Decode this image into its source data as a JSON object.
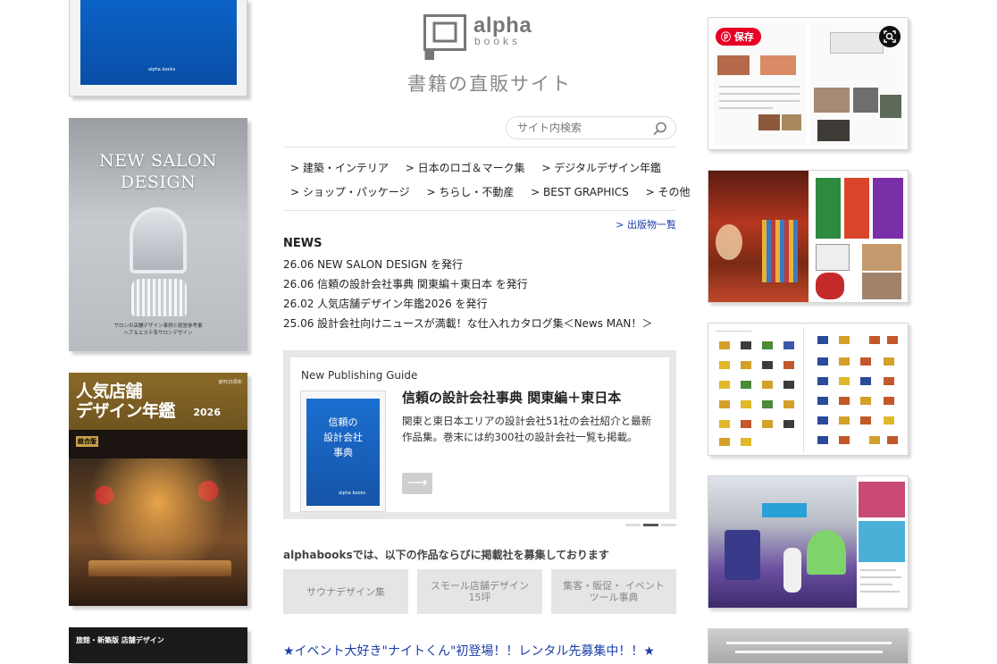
{
  "brand": {
    "name": "alpha",
    "sub": "books",
    "tagline": "書籍の直販サイト"
  },
  "search": {
    "placeholder": "サイト内検索"
  },
  "nav": {
    "row1": [
      "> 建築・インテリア",
      "> 日本のロゴ＆マーク集",
      "> デジタルデザイン年鑑"
    ],
    "row2": [
      "> ショップ・パッケージ",
      "> ちらし・不動産",
      "> BEST GRAPHICS",
      "> その他"
    ],
    "more": "> 出版物一覧"
  },
  "news": {
    "heading": "NEWS",
    "items": [
      "26.06 NEW SALON DESIGN を発行",
      "26.06 信頼の設計会社事典 関東編＋東日本 を発行",
      "26.02 人気店舗デザイン年鑑2026 を発行",
      "25.06 設計会社向けニュースが満載！な仕入れカタログ集＜News MAN！＞"
    ]
  },
  "guide": {
    "label": "New Publishing Guide",
    "title": "信頼の設計会社事典 関東編＋東日本",
    "desc": "関東と東日本エリアの設計会社51社の会社紹介と最新作品集。巻末には約300社の設計会社一覧も掲載。",
    "arrow": "⟶",
    "book_title_1": "信頼の",
    "book_title_2": "設計会社",
    "book_title_3": "事典",
    "book_logo": "alpha books"
  },
  "recruit": {
    "heading": "alphabooksでは、以下の作品ならびに掲載社を募集しております",
    "tiles": [
      "サウナデザイン集",
      "スモール店舗デザイン 15坪",
      "集客・販促・ イベントツール事典"
    ]
  },
  "event": "★イベント大好き\"ナイトくん\"初登場！！レンタル先募集中！！★",
  "covers": {
    "c1_logo": "alpha books",
    "c2_title_1": "NEW SALON",
    "c2_title_2": "DESIGN",
    "c2_sub_1": "サロンの店舗デザイン事例と経営参考書",
    "c2_sub_2": "ヘア＆エステ系サロンデザイン",
    "c3_title_1": "人気店舗",
    "c3_title_2": "デザイン年鑑",
    "c3_year": "2026",
    "c3_tag": "創刊15周年",
    "c3_badge": "総合版",
    "c4_title": "旅館・新築版 店舗デザイン"
  },
  "thumbs": {
    "pin_label": "保存"
  },
  "colors": {
    "link": "#1a3ea8",
    "pinterest": "#e60023",
    "tile_bg": "#e5e5e5"
  }
}
